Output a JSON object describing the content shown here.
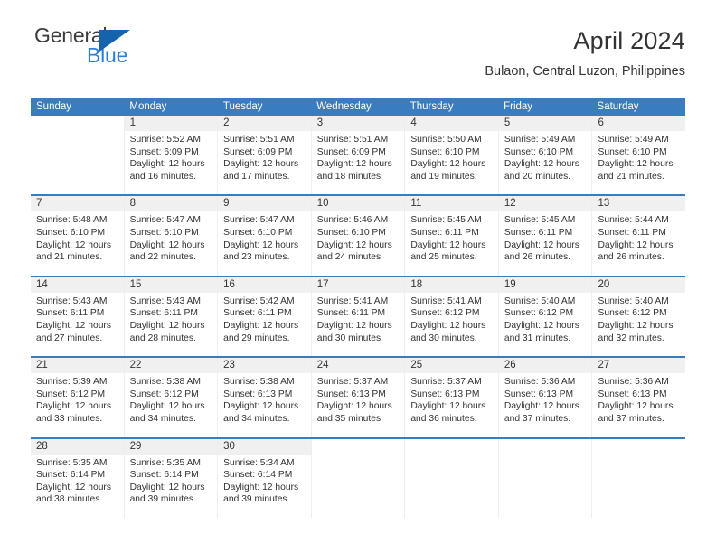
{
  "brand": {
    "name_part1": "General",
    "name_part2": "Blue",
    "triangle_color": "#1463ab",
    "blue_color": "#2a7fd4"
  },
  "header": {
    "title": "April 2024",
    "subtitle": "Bulaon, Central Luzon, Philippines"
  },
  "calendar": {
    "header_bg": "#3a7cc0",
    "daynum_bg": "#f0f0f0",
    "weekdays": [
      "Sunday",
      "Monday",
      "Tuesday",
      "Wednesday",
      "Thursday",
      "Friday",
      "Saturday"
    ],
    "weeks": [
      [
        {
          "day": "",
          "lines": []
        },
        {
          "day": "1",
          "lines": [
            "Sunrise: 5:52 AM",
            "Sunset: 6:09 PM",
            "Daylight: 12 hours",
            "and 16 minutes."
          ]
        },
        {
          "day": "2",
          "lines": [
            "Sunrise: 5:51 AM",
            "Sunset: 6:09 PM",
            "Daylight: 12 hours",
            "and 17 minutes."
          ]
        },
        {
          "day": "3",
          "lines": [
            "Sunrise: 5:51 AM",
            "Sunset: 6:09 PM",
            "Daylight: 12 hours",
            "and 18 minutes."
          ]
        },
        {
          "day": "4",
          "lines": [
            "Sunrise: 5:50 AM",
            "Sunset: 6:10 PM",
            "Daylight: 12 hours",
            "and 19 minutes."
          ]
        },
        {
          "day": "5",
          "lines": [
            "Sunrise: 5:49 AM",
            "Sunset: 6:10 PM",
            "Daylight: 12 hours",
            "and 20 minutes."
          ]
        },
        {
          "day": "6",
          "lines": [
            "Sunrise: 5:49 AM",
            "Sunset: 6:10 PM",
            "Daylight: 12 hours",
            "and 21 minutes."
          ]
        }
      ],
      [
        {
          "day": "7",
          "lines": [
            "Sunrise: 5:48 AM",
            "Sunset: 6:10 PM",
            "Daylight: 12 hours",
            "and 21 minutes."
          ]
        },
        {
          "day": "8",
          "lines": [
            "Sunrise: 5:47 AM",
            "Sunset: 6:10 PM",
            "Daylight: 12 hours",
            "and 22 minutes."
          ]
        },
        {
          "day": "9",
          "lines": [
            "Sunrise: 5:47 AM",
            "Sunset: 6:10 PM",
            "Daylight: 12 hours",
            "and 23 minutes."
          ]
        },
        {
          "day": "10",
          "lines": [
            "Sunrise: 5:46 AM",
            "Sunset: 6:10 PM",
            "Daylight: 12 hours",
            "and 24 minutes."
          ]
        },
        {
          "day": "11",
          "lines": [
            "Sunrise: 5:45 AM",
            "Sunset: 6:11 PM",
            "Daylight: 12 hours",
            "and 25 minutes."
          ]
        },
        {
          "day": "12",
          "lines": [
            "Sunrise: 5:45 AM",
            "Sunset: 6:11 PM",
            "Daylight: 12 hours",
            "and 26 minutes."
          ]
        },
        {
          "day": "13",
          "lines": [
            "Sunrise: 5:44 AM",
            "Sunset: 6:11 PM",
            "Daylight: 12 hours",
            "and 26 minutes."
          ]
        }
      ],
      [
        {
          "day": "14",
          "lines": [
            "Sunrise: 5:43 AM",
            "Sunset: 6:11 PM",
            "Daylight: 12 hours",
            "and 27 minutes."
          ]
        },
        {
          "day": "15",
          "lines": [
            "Sunrise: 5:43 AM",
            "Sunset: 6:11 PM",
            "Daylight: 12 hours",
            "and 28 minutes."
          ]
        },
        {
          "day": "16",
          "lines": [
            "Sunrise: 5:42 AM",
            "Sunset: 6:11 PM",
            "Daylight: 12 hours",
            "and 29 minutes."
          ]
        },
        {
          "day": "17",
          "lines": [
            "Sunrise: 5:41 AM",
            "Sunset: 6:11 PM",
            "Daylight: 12 hours",
            "and 30 minutes."
          ]
        },
        {
          "day": "18",
          "lines": [
            "Sunrise: 5:41 AM",
            "Sunset: 6:12 PM",
            "Daylight: 12 hours",
            "and 30 minutes."
          ]
        },
        {
          "day": "19",
          "lines": [
            "Sunrise: 5:40 AM",
            "Sunset: 6:12 PM",
            "Daylight: 12 hours",
            "and 31 minutes."
          ]
        },
        {
          "day": "20",
          "lines": [
            "Sunrise: 5:40 AM",
            "Sunset: 6:12 PM",
            "Daylight: 12 hours",
            "and 32 minutes."
          ]
        }
      ],
      [
        {
          "day": "21",
          "lines": [
            "Sunrise: 5:39 AM",
            "Sunset: 6:12 PM",
            "Daylight: 12 hours",
            "and 33 minutes."
          ]
        },
        {
          "day": "22",
          "lines": [
            "Sunrise: 5:38 AM",
            "Sunset: 6:12 PM",
            "Daylight: 12 hours",
            "and 34 minutes."
          ]
        },
        {
          "day": "23",
          "lines": [
            "Sunrise: 5:38 AM",
            "Sunset: 6:13 PM",
            "Daylight: 12 hours",
            "and 34 minutes."
          ]
        },
        {
          "day": "24",
          "lines": [
            "Sunrise: 5:37 AM",
            "Sunset: 6:13 PM",
            "Daylight: 12 hours",
            "and 35 minutes."
          ]
        },
        {
          "day": "25",
          "lines": [
            "Sunrise: 5:37 AM",
            "Sunset: 6:13 PM",
            "Daylight: 12 hours",
            "and 36 minutes."
          ]
        },
        {
          "day": "26",
          "lines": [
            "Sunrise: 5:36 AM",
            "Sunset: 6:13 PM",
            "Daylight: 12 hours",
            "and 37 minutes."
          ]
        },
        {
          "day": "27",
          "lines": [
            "Sunrise: 5:36 AM",
            "Sunset: 6:13 PM",
            "Daylight: 12 hours",
            "and 37 minutes."
          ]
        }
      ],
      [
        {
          "day": "28",
          "lines": [
            "Sunrise: 5:35 AM",
            "Sunset: 6:14 PM",
            "Daylight: 12 hours",
            "and 38 minutes."
          ]
        },
        {
          "day": "29",
          "lines": [
            "Sunrise: 5:35 AM",
            "Sunset: 6:14 PM",
            "Daylight: 12 hours",
            "and 39 minutes."
          ]
        },
        {
          "day": "30",
          "lines": [
            "Sunrise: 5:34 AM",
            "Sunset: 6:14 PM",
            "Daylight: 12 hours",
            "and 39 minutes."
          ]
        },
        {
          "day": "",
          "lines": []
        },
        {
          "day": "",
          "lines": []
        },
        {
          "day": "",
          "lines": []
        },
        {
          "day": "",
          "lines": []
        }
      ]
    ]
  }
}
